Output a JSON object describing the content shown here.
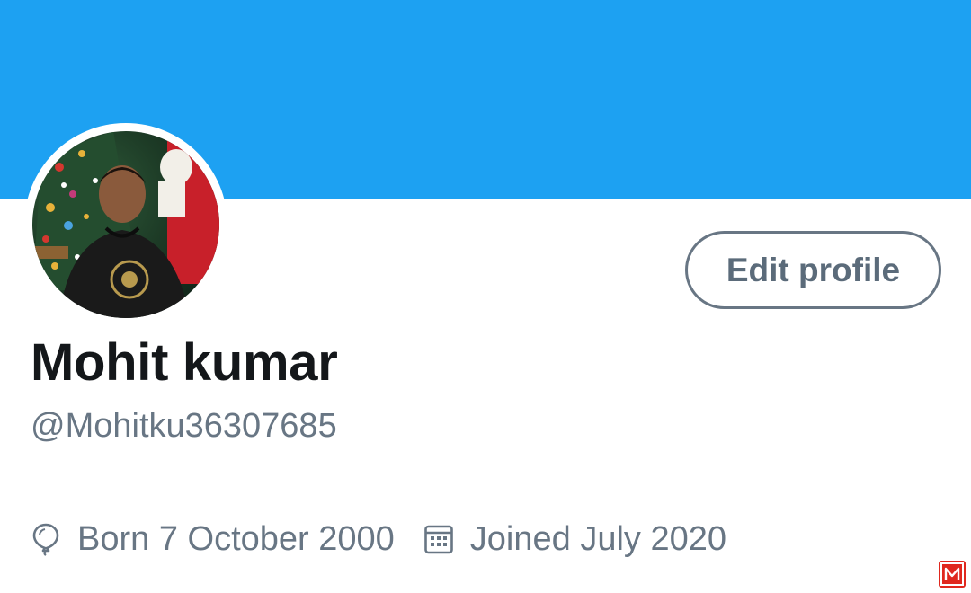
{
  "profile": {
    "display_name": "Mohit kumar",
    "handle": "@Mohitku36307685",
    "edit_button_label": "Edit profile",
    "birthday": "Born 7 October 2000",
    "joined": "Joined July 2020"
  },
  "icons": {
    "birthday": "balloon-icon",
    "joined": "calendar-icon",
    "watermark": "logo-icon"
  },
  "colors": {
    "banner": "#1da1f2",
    "text_primary": "#14171a",
    "text_secondary": "#687684",
    "watermark": "#e0281e"
  }
}
